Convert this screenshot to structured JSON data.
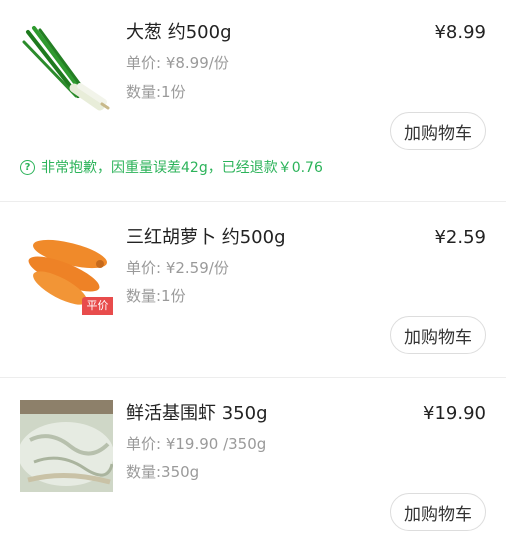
{
  "items": [
    {
      "name": "大葱 约500g",
      "price": "¥8.99",
      "unit_price": "单价: ¥8.99/份",
      "quantity": "数量:1份",
      "button_label": "加购物车"
    },
    {
      "name": "三红胡萝卜 约500g",
      "price": "¥2.59",
      "unit_price": "单价: ¥2.59/份",
      "quantity": "数量:1份",
      "button_label": "加购物车",
      "badge": "平价"
    },
    {
      "name": "鲜活基围虾 350g",
      "price": "¥19.90",
      "unit_price": "单价: ¥19.90 /350g",
      "quantity": "数量:350g",
      "button_label": "加购物车"
    }
  ],
  "refund_notice": {
    "icon": "?",
    "text": "非常抱歉，因重量误差42g，已经退款￥0.76",
    "color": "#2cb35a"
  }
}
